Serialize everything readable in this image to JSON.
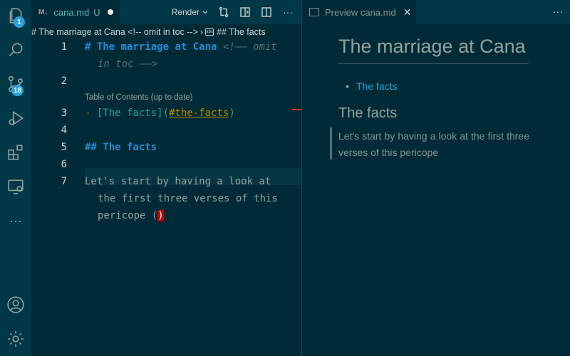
{
  "activity_bar": {
    "items": [
      {
        "name": "explorer",
        "badge": "1"
      },
      {
        "name": "search",
        "badge": ""
      },
      {
        "name": "source-control",
        "badge": "18"
      },
      {
        "name": "run-debug",
        "badge": ""
      },
      {
        "name": "extensions",
        "badge": ""
      },
      {
        "name": "remote-explorer",
        "badge": ""
      },
      {
        "name": "more",
        "badge": ""
      }
    ],
    "bottom": [
      "accounts",
      "manage"
    ]
  },
  "editor": {
    "tab": {
      "icon": "M↓",
      "filename": "cana.md",
      "status": "U"
    },
    "toolbar": {
      "render_label": "Render"
    },
    "breadcrumb": {
      "part1": "# The marriage at Cana <!-- omit in toc -->",
      "part2": "## The facts",
      "abc": "abc"
    },
    "codelens": "Table of Contents (up to date)",
    "line_numbers": [
      "1",
      "2",
      "3",
      "4",
      "5",
      "6",
      "7"
    ],
    "lines": {
      "l1_heading": "# The marriage at Cana",
      "l1_comment": " <!—— omit",
      "l1_comment_cont": "in toc ——>",
      "l3_dash": "- ",
      "l3_link_text": "[The facts]",
      "l3_link_open": "(",
      "l3_link_url": "#the-facts",
      "l3_link_close": ")",
      "l5_heading": "## The facts",
      "l7_a": "Let's start by having a look at",
      "l7_b": "the first three verses of this",
      "l7_c": "pericope (",
      "l7_paren": ")"
    }
  },
  "preview": {
    "tab_label": "Preview cana.md",
    "h1": "The marriage at Cana",
    "toc_item": "The facts",
    "h2": "The facts",
    "quote": "Let's start by having a look at the first three verses of this pericope"
  },
  "colors": {
    "background": "#002b36",
    "accent": "#2aa0d8",
    "heading": "#268bd2"
  }
}
